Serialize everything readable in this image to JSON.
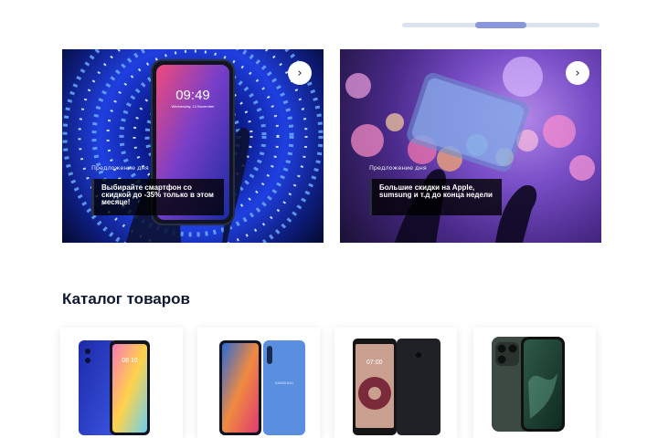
{
  "banners": [
    {
      "kicker": "Предложение дня",
      "caption": "Выбирайте смартфон со скидкой до -35% только в этом месяце!",
      "phone_time": "09:49",
      "phone_date": "Wednesday, 13 November"
    },
    {
      "kicker": "Предложение дня",
      "caption": "Большие скидки на Apple, sumsung и т.д до конца недели"
    }
  ],
  "catalog": {
    "title": "Каталог товаров",
    "products": [
      {
        "icon": "xiaomi-phone-image",
        "screen_text": "08 16"
      },
      {
        "icon": "samsung-phone-image",
        "brand_text": "SAMSUNG"
      },
      {
        "icon": "lg-phone-image",
        "screen_text": "07:00"
      },
      {
        "icon": "iphone-phone-image"
      }
    ]
  },
  "colors": {
    "slider_track": "#dde2f0",
    "slider_thumb": "#8a97d9",
    "heading": "#0f1830"
  }
}
